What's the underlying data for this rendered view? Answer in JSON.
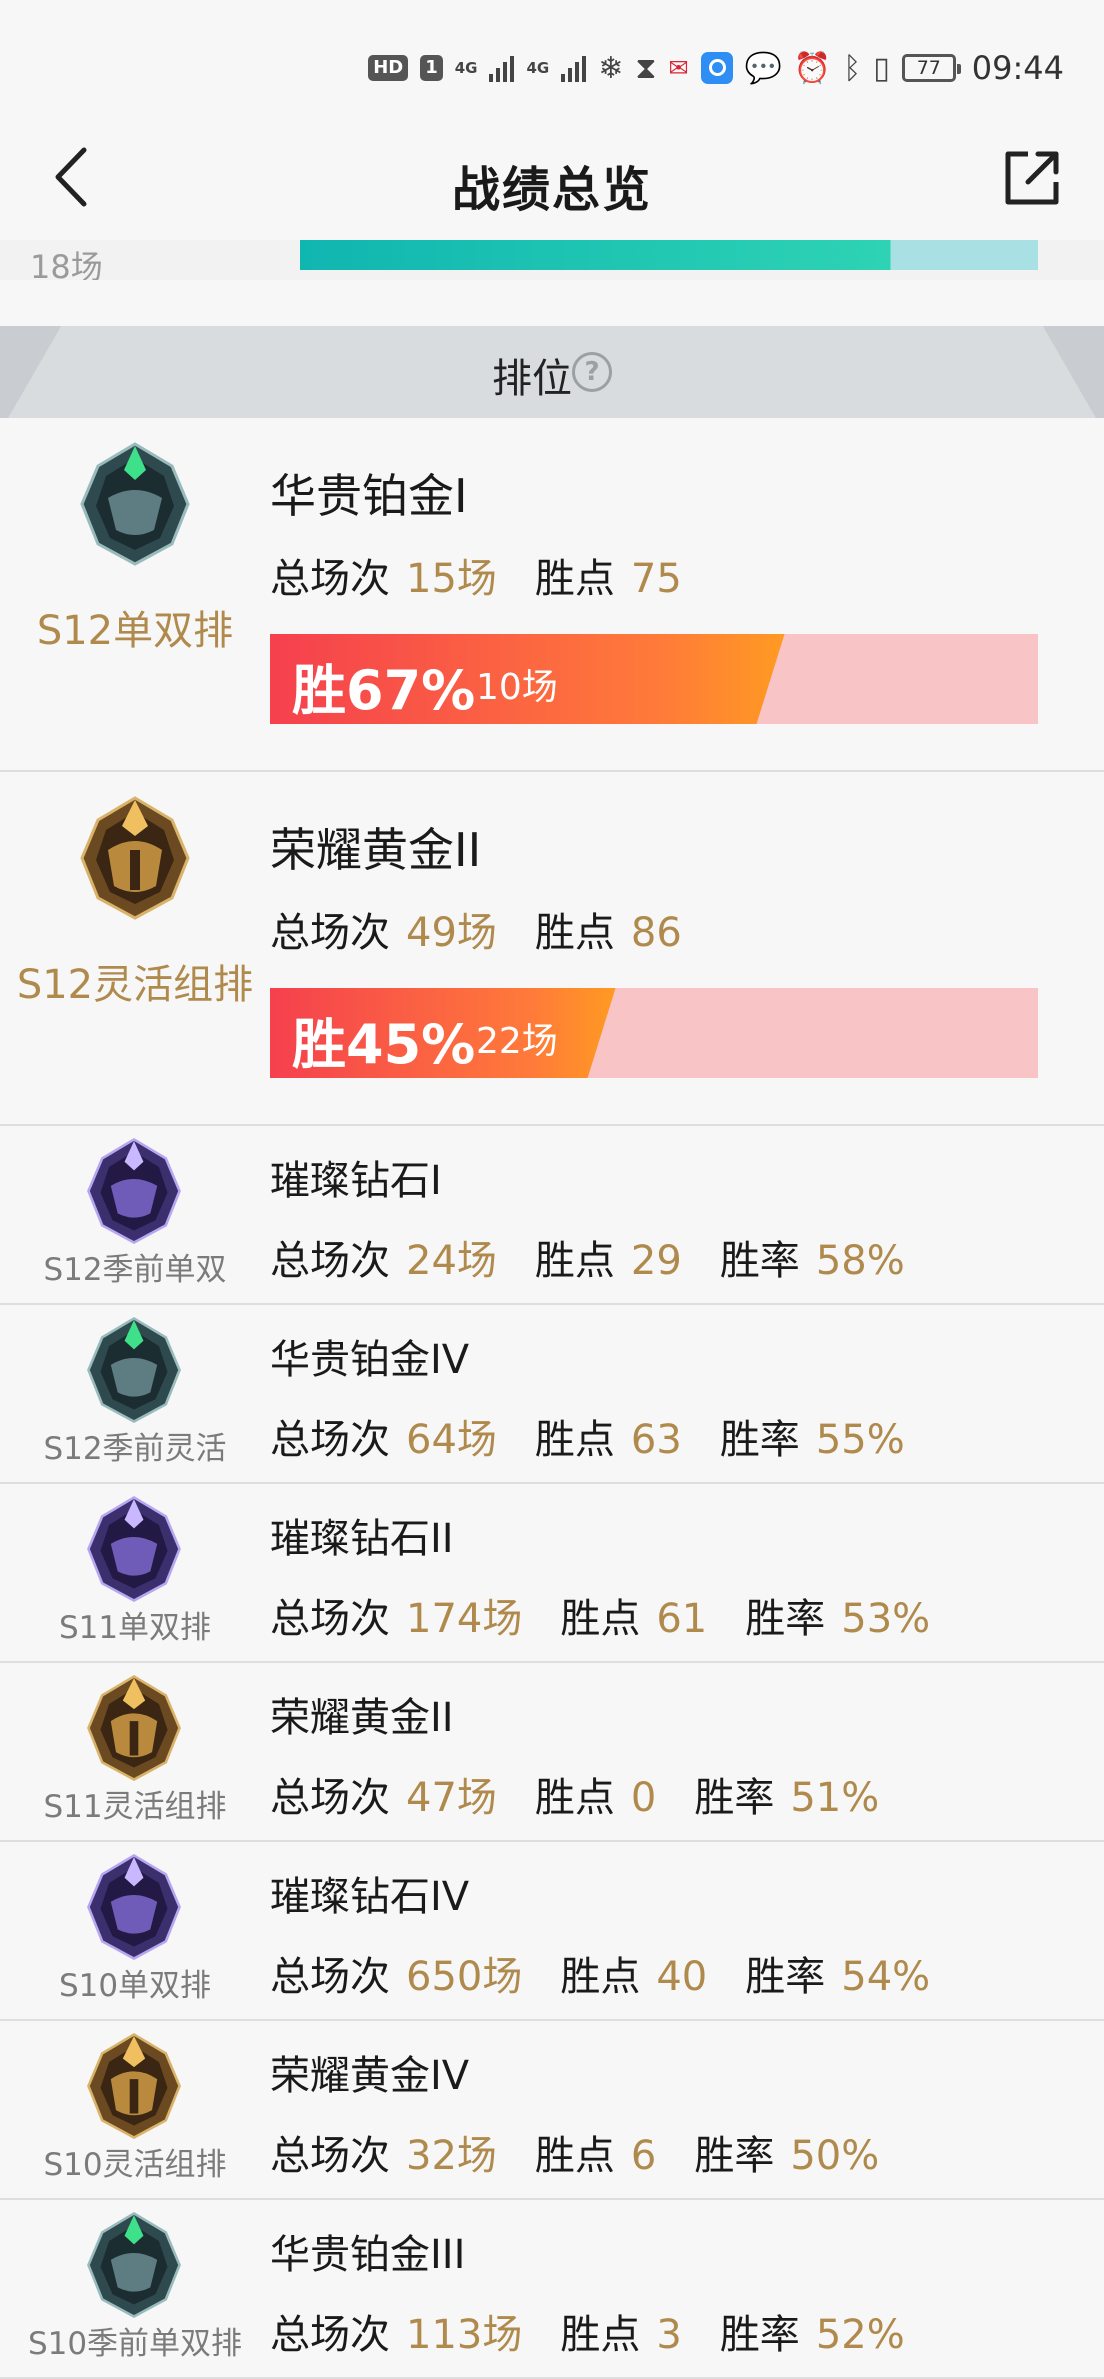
{
  "status_bar": {
    "hd_badge": "HD",
    "sim": "1",
    "net1": "4G",
    "net2": "4G",
    "battery": "77",
    "time": "09:44"
  },
  "nav": {
    "title": "战绩总览"
  },
  "partial_card": {
    "count": "18场"
  },
  "section": {
    "title": "排位",
    "help": "?"
  },
  "colors": {
    "accent_gold": "#b08a4c",
    "win_red": "#f5404e",
    "win_orange": "#ff9a22",
    "loss_pink": "#f8c4c6"
  },
  "ranks": [
    {
      "queue": "S12单双排",
      "tier": "华贵铂金I",
      "emblem": "platinum-emblem",
      "total_label": "总场次",
      "total": "15场",
      "lp_label": "胜点",
      "lp": "75",
      "win_label": "胜67%",
      "win_games": "10场",
      "win_rate": 0.67
    },
    {
      "queue": "S12灵活组排",
      "tier": "荣耀黄金II",
      "emblem": "gold-emblem",
      "total_label": "总场次",
      "total": "49场",
      "lp_label": "胜点",
      "lp": "86",
      "win_label": "胜45%",
      "win_games": "22场",
      "win_rate": 0.45
    },
    {
      "queue": "S12季前单双",
      "tier": "璀璨钻石I",
      "emblem": "diamond-emblem",
      "total_label": "总场次",
      "total": "24场",
      "lp_label": "胜点",
      "lp": "29",
      "rate_label": "胜率",
      "rate": "58%"
    },
    {
      "queue": "S12季前灵活",
      "tier": "华贵铂金IV",
      "emblem": "platinum-emblem",
      "total_label": "总场次",
      "total": "64场",
      "lp_label": "胜点",
      "lp": "63",
      "rate_label": "胜率",
      "rate": "55%"
    },
    {
      "queue": "S11单双排",
      "tier": "璀璨钻石II",
      "emblem": "diamond-emblem",
      "total_label": "总场次",
      "total": "174场",
      "lp_label": "胜点",
      "lp": "61",
      "rate_label": "胜率",
      "rate": "53%"
    },
    {
      "queue": "S11灵活组排",
      "tier": "荣耀黄金II",
      "emblem": "gold-emblem",
      "total_label": "总场次",
      "total": "47场",
      "lp_label": "胜点",
      "lp": "0",
      "rate_label": "胜率",
      "rate": "51%"
    },
    {
      "queue": "S10单双排",
      "tier": "璀璨钻石IV",
      "emblem": "diamond-emblem",
      "total_label": "总场次",
      "total": "650场",
      "lp_label": "胜点",
      "lp": "40",
      "rate_label": "胜率",
      "rate": "54%"
    },
    {
      "queue": "S10灵活组排",
      "tier": "荣耀黄金IV",
      "emblem": "gold-emblem",
      "total_label": "总场次",
      "total": "32场",
      "lp_label": "胜点",
      "lp": "6",
      "rate_label": "胜率",
      "rate": "50%"
    },
    {
      "queue": "S10季前单双排",
      "tier": "华贵铂金III",
      "emblem": "platinum-emblem",
      "total_label": "总场次",
      "total": "113场",
      "lp_label": "胜点",
      "lp": "3",
      "rate_label": "胜率",
      "rate": "52%"
    }
  ]
}
